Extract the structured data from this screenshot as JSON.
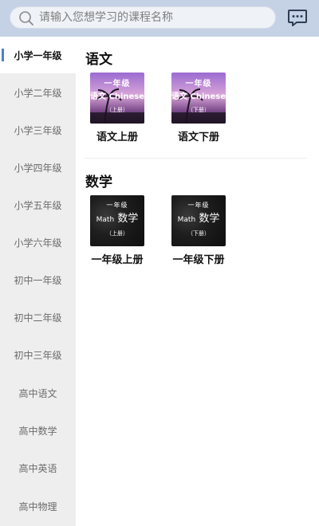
{
  "search": {
    "placeholder": "请输入您想学习的课程名称",
    "icon": "search-icon"
  },
  "header": {
    "message_icon": "chat-icon"
  },
  "colors": {
    "header_bg": "#c5d2e6",
    "sidebar_bg": "#eeeeee",
    "active_bar": "#4b82c8"
  },
  "sidebar": {
    "items": [
      {
        "label": "小学一年级",
        "active": true
      },
      {
        "label": "小学二年级"
      },
      {
        "label": "小学三年级"
      },
      {
        "label": "小学四年级"
      },
      {
        "label": "小学五年级"
      },
      {
        "label": "小学六年级"
      },
      {
        "label": "初中一年级"
      },
      {
        "label": "初中二年级"
      },
      {
        "label": "初中三年级"
      },
      {
        "label": "高中语文"
      },
      {
        "label": "高中数学"
      },
      {
        "label": "高中英语"
      },
      {
        "label": "高中物理"
      }
    ]
  },
  "sections": [
    {
      "title": "语文",
      "books": [
        {
          "cover_line1": "一年级",
          "cover_line2": "语文 Chinese",
          "cover_line3": "（上册）",
          "label": "语文上册"
        },
        {
          "cover_line1": "一年级",
          "cover_line2": "语文 Chinese",
          "cover_line3": "（下册）",
          "label": "语文下册"
        }
      ]
    },
    {
      "title": "数学",
      "books": [
        {
          "cover_line1": "一年级",
          "cover_line2_a": "Math",
          "cover_line2_b": "数学",
          "cover_line3": "（上册）",
          "label": "一年级上册"
        },
        {
          "cover_line1": "一年级",
          "cover_line2_a": "Math",
          "cover_line2_b": "数学",
          "cover_line3": "（下册）",
          "label": "一年级下册"
        }
      ]
    }
  ]
}
